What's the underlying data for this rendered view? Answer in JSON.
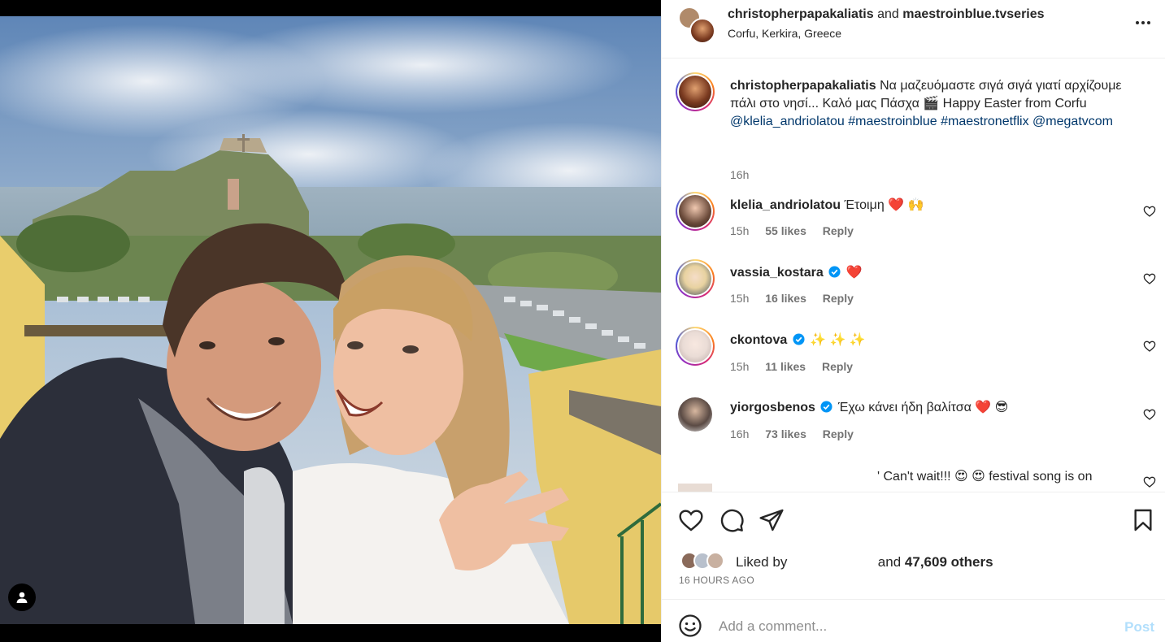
{
  "header": {
    "user1": "christopherpapakaliatis",
    "and_text": "and",
    "user2": "maestroinblue.tvseries",
    "location": "Corfu, Kerkira, Greece",
    "more_icon": "more-horizontal-icon"
  },
  "caption": {
    "user": "christopherpapakaliatis",
    "text_part1": "Να μαζευόμαστε σιγά σιγά γιατί αρχίζουμε πάλι στο νησί... Καλό μας Πάσχα 🎬 Happy Easter from Corfu",
    "mention1": "@klelia_andriolatou",
    "hashtag1": "#maestroinblue",
    "hashtag2": "#maestronetflix",
    "mention2": "@megatvcom",
    "time": "16h"
  },
  "comments": [
    {
      "user": "klelia_andriolatou",
      "verified": false,
      "text": "Έτοιμη ❤️ 🙌",
      "time": "15h",
      "likes": "55 likes",
      "reply": "Reply"
    },
    {
      "user": "vassia_kostara",
      "verified": true,
      "text": "❤️",
      "time": "15h",
      "likes": "16 likes",
      "reply": "Reply"
    },
    {
      "user": "ckontova",
      "verified": true,
      "text": "✨ ✨ ✨",
      "time": "15h",
      "likes": "11 likes",
      "reply": "Reply"
    },
    {
      "user": "yiorgosbenos",
      "verified": true,
      "text": "Έχω κάνει ήδη βαλίτσα ❤️ 😎",
      "time": "16h",
      "likes": "73 likes",
      "reply": "Reply"
    },
    {
      "user": "",
      "verified": false,
      "text": "' Can't wait!!! 😍 😍 festival song is on",
      "time": "",
      "likes": "",
      "reply": ""
    }
  ],
  "actions": {
    "like_icon": "heart-icon",
    "comment_icon": "comment-icon",
    "share_icon": "share-icon",
    "save_icon": "bookmark-icon"
  },
  "likes": {
    "prefix": "Liked by",
    "and_text": "and",
    "count": "47,609 others"
  },
  "posted_ago": "16 HOURS AGO",
  "add_comment": {
    "placeholder": "Add a comment...",
    "post_label": "Post",
    "emoji_icon": "smiley-icon"
  },
  "colors": {
    "link": "#00376b",
    "verified": "#0095f6",
    "post_disabled": "#b2dffc",
    "muted": "#737373"
  }
}
